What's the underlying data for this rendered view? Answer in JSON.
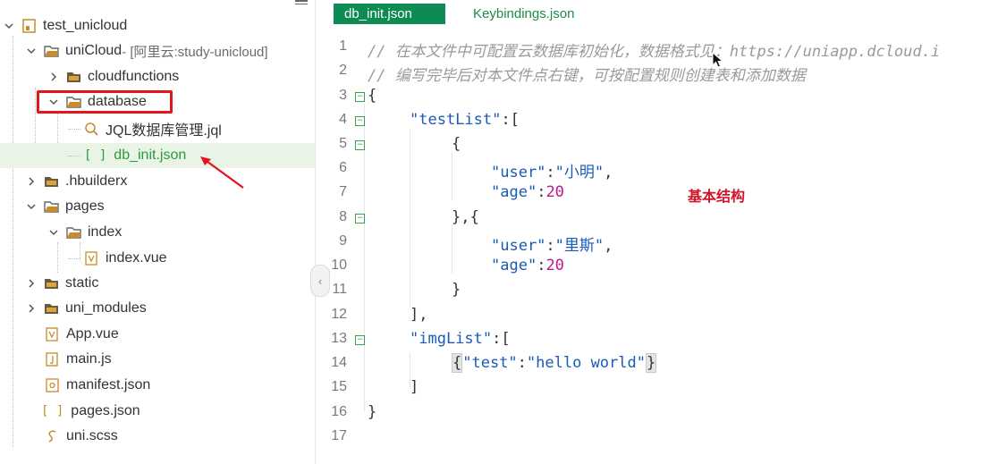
{
  "sidebar": {
    "items": [
      {
        "label": "test_unicloud"
      },
      {
        "label": "uniCloud",
        "sub": " - [阿里云:study-unicloud]"
      },
      {
        "label": "cloudfunctions"
      },
      {
        "label": "database"
      },
      {
        "label": "JQL数据库管理.jql"
      },
      {
        "label": "db_init.json"
      },
      {
        "label": ".hbuilderx"
      },
      {
        "label": "pages"
      },
      {
        "label": "index"
      },
      {
        "label": "index.vue"
      },
      {
        "label": "static"
      },
      {
        "label": "uni_modules"
      },
      {
        "label": "App.vue"
      },
      {
        "label": "main.js"
      },
      {
        "label": "manifest.json"
      },
      {
        "label": "pages.json"
      },
      {
        "label": "uni.scss"
      }
    ]
  },
  "tabs": [
    {
      "label": "db_init.json"
    },
    {
      "label": "Keybindings.json"
    }
  ],
  "editor": {
    "line_numbers": [
      "1",
      "2",
      "3",
      "4",
      "5",
      "6",
      "7",
      "8",
      "9",
      "10",
      "11",
      "12",
      "13",
      "14",
      "15",
      "16",
      "17"
    ],
    "line1": "// 在本文件中可配置云数据库初始化，数据格式见：https://uniapp.dcloud.i",
    "line2": "// 编写完毕后对本文件点右键，可按配置规则创建表和添加数据",
    "line3": "{",
    "line4_key": "\"testList\"",
    "line4_rest": ":[",
    "line5": "{",
    "line6_key": "\"user\"",
    "line6_colon": ":",
    "line6_val": "\"小明\"",
    "line6_end": ",",
    "line7_key": "\"age\"",
    "line7_colon": ":",
    "line7_val": "20",
    "line8": "},{",
    "line9_key": "\"user\"",
    "line9_colon": ":",
    "line9_val": "\"里斯\"",
    "line9_end": ",",
    "line10_key": "\"age\"",
    "line10_colon": ":",
    "line10_val": "20",
    "line11": "}",
    "line12": "],",
    "line13_key": "\"imgList\"",
    "line13_rest": ":[",
    "line14_open": "{",
    "line14_key": "\"test\"",
    "line14_colon": ":",
    "line14_val": "\"hello world\"",
    "line14_close": "}",
    "line15": "]",
    "line16": "}",
    "annotation": "基本结构"
  },
  "colors": {
    "accent": "#0e8a55",
    "selection": "#e9f4e6",
    "highlight_box": "#e6141b",
    "annotation": "#d2142a"
  }
}
